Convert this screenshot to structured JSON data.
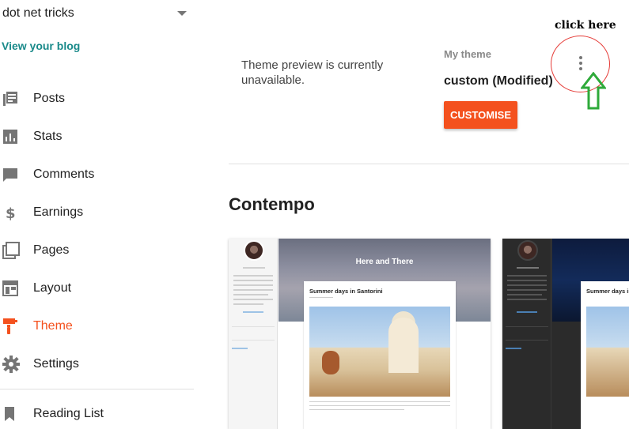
{
  "sidebar": {
    "blog_name": "dot net tricks",
    "view_blog": "View your blog",
    "items": [
      {
        "label": "Posts",
        "icon": "posts-icon"
      },
      {
        "label": "Stats",
        "icon": "stats-icon"
      },
      {
        "label": "Comments",
        "icon": "comments-icon"
      },
      {
        "label": "Earnings",
        "icon": "earnings-icon"
      },
      {
        "label": "Pages",
        "icon": "pages-icon"
      },
      {
        "label": "Layout",
        "icon": "layout-icon"
      },
      {
        "label": "Theme",
        "icon": "theme-icon",
        "active": true
      },
      {
        "label": "Settings",
        "icon": "settings-icon"
      },
      {
        "label": "Reading List",
        "icon": "reading-list-icon"
      }
    ]
  },
  "main": {
    "preview_message": "Theme preview is currently unavailable.",
    "my_theme_label": "My theme",
    "theme_name": "custom (Modified)",
    "customise_label": "CUSTOMISE",
    "annotation_text": "click here",
    "section_title": "Contempo",
    "cards": [
      {
        "hero_title": "Here and There",
        "post_title": "Summer days in Santorini"
      },
      {
        "post_title": "Summer days in S"
      }
    ]
  },
  "colors": {
    "accent": "#f4511e",
    "link": "#1a8a8a",
    "annotation_circle": "#e53935",
    "annotation_arrow": "#2eaa3a"
  }
}
